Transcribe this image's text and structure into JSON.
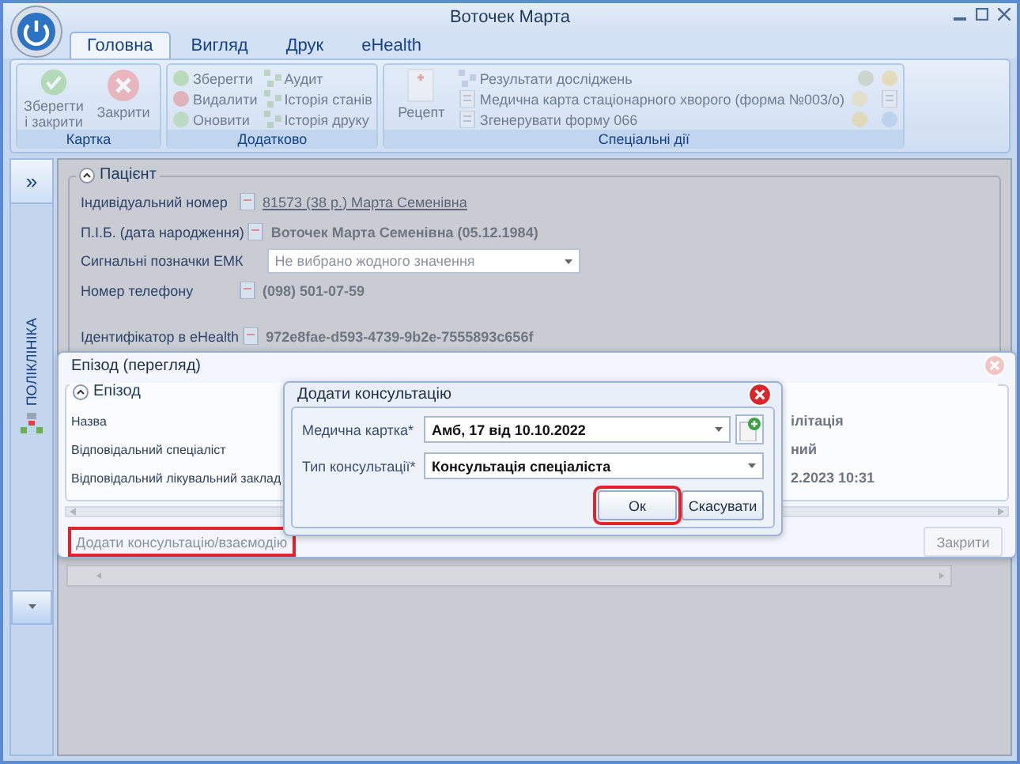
{
  "window": {
    "title": "Воточек Марта"
  },
  "tabs": [
    {
      "label": "Головна",
      "selected": true
    },
    {
      "label": "Вигляд",
      "selected": false
    },
    {
      "label": "Друк",
      "selected": false
    },
    {
      "label": "eHealth",
      "selected": false
    }
  ],
  "ribbon": {
    "groups": [
      {
        "label": "Картка",
        "buttons": [
          {
            "kind": "large",
            "label": "Зберегти і закрити",
            "disabled": true
          },
          {
            "kind": "large",
            "label": "Закрити",
            "disabled": true
          }
        ]
      },
      {
        "label": "Додатково",
        "buttons": [
          {
            "kind": "small",
            "label": "Зберегти",
            "disabled": true
          },
          {
            "kind": "small",
            "label": "Видалити",
            "disabled": true
          },
          {
            "kind": "small",
            "label": "Оновити",
            "disabled": true
          },
          {
            "kind": "small",
            "label": "Аудит",
            "disabled": true
          },
          {
            "kind": "small",
            "label": "Історія станів",
            "disabled": true
          },
          {
            "kind": "small",
            "label": "Історія друку",
            "disabled": true
          }
        ]
      },
      {
        "label": "Спеціальні дії",
        "buttons": [
          {
            "kind": "large",
            "label": "Рецепт",
            "disabled": true
          },
          {
            "kind": "small",
            "label": "Результати досліджень",
            "disabled": true
          },
          {
            "kind": "small",
            "label": "Медична карта стаціонарного хворого (форма №003/о)",
            "disabled": true
          },
          {
            "kind": "small",
            "label": "Згенерувати форму 066",
            "disabled": true
          },
          {
            "kind": "icon",
            "disabled": true
          },
          {
            "kind": "icon",
            "disabled": true
          },
          {
            "kind": "icon",
            "disabled": true
          },
          {
            "kind": "icon",
            "disabled": true
          },
          {
            "kind": "icon",
            "disabled": true
          },
          {
            "kind": "icon",
            "disabled": true
          }
        ]
      }
    ]
  },
  "sidebar": {
    "expand_button": "»",
    "title": "ПОЛІКЛІНІКА"
  },
  "patient": {
    "legend": "Пацієнт",
    "fields": [
      {
        "kind": "link",
        "label": "Індивідуальний номер",
        "value": "81573 (38 р.) Марта Семенівна"
      },
      {
        "kind": "text",
        "label": "П.І.Б. (дата народження)",
        "value": "Воточек Марта Семенівна (05.12.1984)"
      },
      {
        "kind": "select",
        "label": "Сигнальні позначки ЕМК",
        "placeholder": "Не вибрано жодного значення"
      },
      {
        "kind": "text",
        "label": "Номер телефону",
        "value": "(098) 501-07-59"
      },
      {
        "kind": "text",
        "label": "Ідентифікатор в eHealth",
        "value": "972e8fae-d593-4739-9b2e-7555893c656f"
      }
    ]
  },
  "episode": {
    "title": "Епізод (перегляд)",
    "legend": "Епізод",
    "fields": [
      {
        "label": "Назва",
        "value": "ілітація"
      },
      {
        "label": "Відповідальний спеціаліст",
        "value": "ний"
      },
      {
        "label": "Відповідальний лікувальний заклад",
        "value": "2.2023 10:31"
      }
    ],
    "add_button": {
      "label": "Додати консультацію/взаємодію",
      "disabled": true,
      "highlighted": true
    },
    "close_button": {
      "label": "Закрити",
      "disabled": true
    }
  },
  "consultation": {
    "title": "Додати консультацію",
    "fields": [
      {
        "kind": "addable",
        "label": "Медична картка*",
        "value": "Амб, 17 від 10.10.2022"
      },
      {
        "kind": "plain",
        "label": "Тип консультації*",
        "value": "Консультація спеціаліста"
      }
    ],
    "ok_button": {
      "label": "Ок",
      "highlighted": true
    },
    "cancel_button": {
      "label": "Скасувати",
      "highlighted": false
    }
  }
}
